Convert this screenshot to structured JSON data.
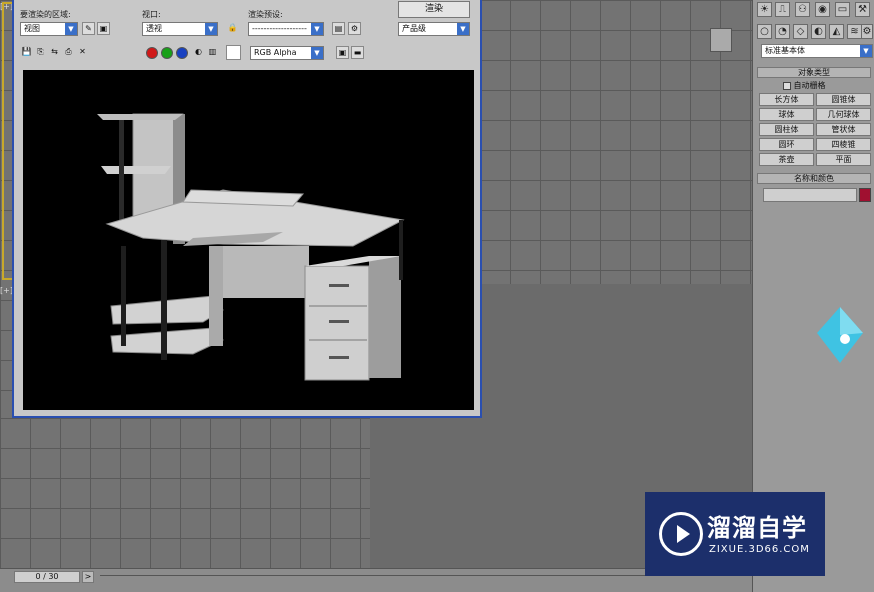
{
  "render_window": {
    "area_label": "要渲染的区域:",
    "area_value": "视图",
    "viewport_label": "视口:",
    "viewport_value": "透视",
    "preset_label": "渲染预设:",
    "preset_value": "-------------------",
    "preset_mode": "产品级",
    "render_button": "渲染",
    "channel_value": "RGB Alpha"
  },
  "command_panel": {
    "category_dropdown": "标准基本体",
    "object_type_header": "对象类型",
    "autogrid_label": "自动栅格",
    "object_buttons": [
      "长方体",
      "圆锥体",
      "球体",
      "几何球体",
      "圆柱体",
      "管状体",
      "圆环",
      "四棱锥",
      "茶壶",
      "平面"
    ],
    "name_color_header": "名称和颜色",
    "name_value": "",
    "object_color": "#a01030"
  },
  "timeline": {
    "frame_counter": "0 / 30",
    "next_arrow": ">"
  },
  "viewports": {
    "left_label": "[+]",
    "left_label_bottom": "[+]"
  },
  "watermark": {
    "brand": "溜溜自学",
    "url": "ZIXUE.3D66.COM"
  },
  "colors": {
    "render_border": "#2a4fb0",
    "selection_frame": "#c9a92a",
    "safe_frame": "#5bd0d0",
    "watermark_bg": "#1c2f6b",
    "logo_cyan": "#3fc3e3"
  }
}
